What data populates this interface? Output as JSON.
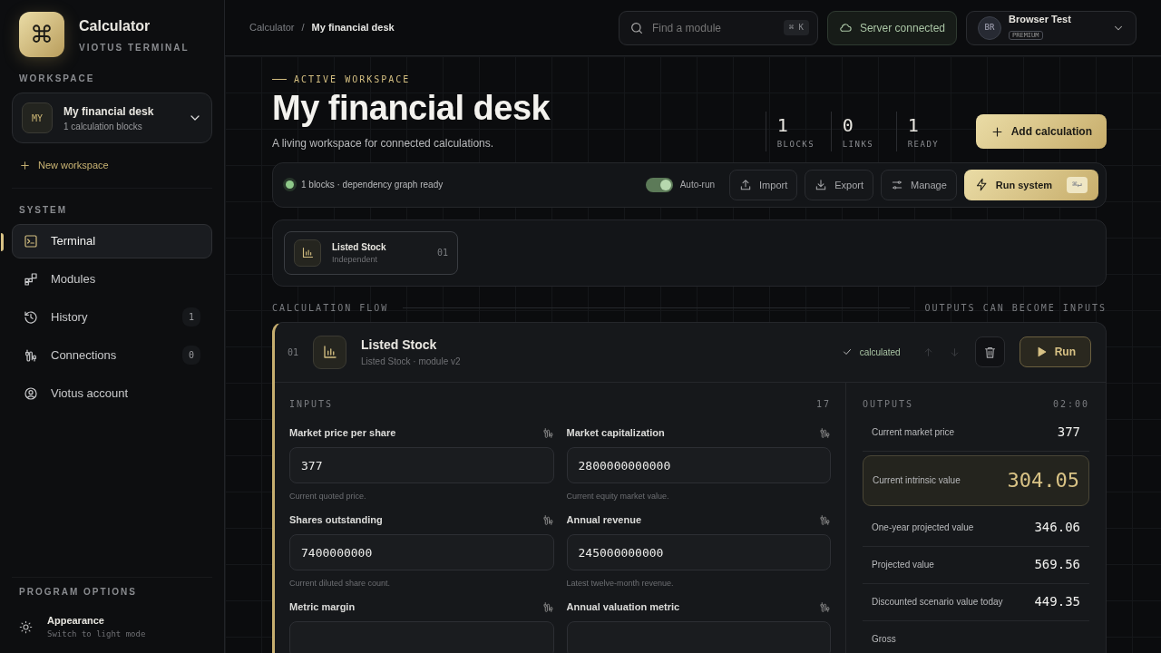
{
  "app": {
    "logo_glyph": "⌘",
    "name": "Calculator",
    "subtitle": "VIOTUS TERMINAL"
  },
  "sidebar": {
    "workspace_label": "WORKSPACE",
    "workspace": {
      "avatar": "MY",
      "name": "My financial desk",
      "meta": "1 calculation blocks"
    },
    "new_workspace": "New workspace",
    "system_label": "SYSTEM",
    "items": [
      {
        "label": "Terminal",
        "selected": true
      },
      {
        "label": "Modules",
        "selected": false
      },
      {
        "label": "History",
        "count": "1",
        "selected": false
      },
      {
        "label": "Connections",
        "count": "0",
        "selected": false
      },
      {
        "label": "Viotus account",
        "selected": false
      }
    ],
    "options_label": "PROGRAM OPTIONS",
    "appearance": {
      "title": "Appearance",
      "hint": "Switch to light mode"
    }
  },
  "topbar": {
    "breadcrumbs": [
      "Calculator",
      "/",
      "My financial desk"
    ],
    "search": {
      "placeholder": "Find a module",
      "shortcut": "⌘ K"
    },
    "server_status": "Server connected",
    "user": {
      "initials": "BR",
      "name": "Browser Test",
      "tier": "PREMIUM"
    }
  },
  "header": {
    "eyebrow": "ACTIVE WORKSPACE",
    "title": "My financial desk",
    "subtitle": "A living workspace for connected calculations.",
    "stats": [
      {
        "value": "1",
        "label": "BLOCKS"
      },
      {
        "value": "0",
        "label": "LINKS"
      },
      {
        "value": "1",
        "label": "READY"
      }
    ],
    "add_button": "Add calculation"
  },
  "toolbar": {
    "status": "1 blocks · dependency graph ready",
    "autorun": {
      "label": "Auto-run",
      "on": true
    },
    "buttons": [
      "Import",
      "Export",
      "Manage"
    ],
    "run_button": {
      "label": "Run system",
      "shortcut": "⌘↵"
    }
  },
  "blocks": [
    {
      "name": "Listed Stock",
      "meta": "Independent",
      "index": "01"
    }
  ],
  "flow": {
    "label_left": "CALCULATION FLOW",
    "label_right": "OUTPUTS CAN BECOME INPUTS"
  },
  "module": {
    "index": "01",
    "name": "Listed Stock",
    "meta": "Listed Stock · module v2",
    "status": "calculated",
    "run_label": "Run",
    "inputs_label": "INPUTS",
    "inputs_count": "17",
    "inputs": [
      {
        "label": "Market price per share",
        "value": "377",
        "hint": "Current quoted price."
      },
      {
        "label": "Market capitalization",
        "value": "2800000000000",
        "hint": "Current equity market value."
      },
      {
        "label": "Shares outstanding",
        "value": "7400000000",
        "hint": "Current diluted share count."
      },
      {
        "label": "Annual revenue",
        "value": "245000000000",
        "hint": "Latest twelve-month revenue."
      },
      {
        "label": "Metric margin"
      },
      {
        "label": "Annual valuation metric"
      }
    ],
    "outputs_label": "OUTPUTS",
    "outputs_time": "02:00",
    "outputs": [
      {
        "label": "Current market price",
        "value": "377",
        "highlighted": false
      },
      {
        "label": "Current intrinsic value",
        "value": "304.05",
        "highlighted": true
      },
      {
        "label": "One-year projected value",
        "value": "346.06",
        "highlighted": false
      },
      {
        "label": "Projected value",
        "value": "569.56",
        "highlighted": false
      },
      {
        "label": "Discounted scenario value today",
        "value": "449.35",
        "highlighted": false
      },
      {
        "label": "Gross",
        "highlighted": false
      }
    ]
  }
}
